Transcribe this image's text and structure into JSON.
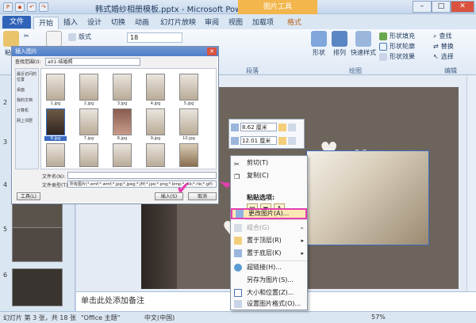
{
  "titlebar": {
    "title": "韩式婚纱相册模板.pptx - Microsoft PowerPoint",
    "context_tab": "图片工具"
  },
  "tabs": [
    "文件",
    "开始",
    "插入",
    "设计",
    "切换",
    "动画",
    "幻灯片放映",
    "审阅",
    "视图",
    "加载项",
    "格式"
  ],
  "ribbon": {
    "paste": "粘贴",
    "cut": "剪切",
    "new_slide": "新建幻灯片",
    "layout": "版式",
    "font_size": "18",
    "section_clipboard": "剪贴板",
    "section_paragraph": "段落",
    "section_drawing": "绘图",
    "section_editing": "编辑",
    "shape": "形状",
    "arrange": "排列",
    "quick_styles": "快速样式",
    "shape_fill": "形状填充",
    "shape_outline": "形状轮廓",
    "shape_effects": "形状效果",
    "find": "查找",
    "replace": "替换",
    "select": "选择"
  },
  "thumbnails": [
    "1",
    "2",
    "3",
    "4",
    "5",
    "6"
  ],
  "dialog": {
    "title": "插入图片",
    "look_in_label": "查找范围(I):",
    "location": "a01-结婚照",
    "places": [
      "最近访问的位置",
      "桌面",
      "我的文档",
      "计算机",
      "网上邻居"
    ],
    "files": [
      "1.jpg",
      "2.jpg",
      "3.jpg",
      "4.jpg",
      "5.jpg",
      "6.jpg",
      "7.jpg",
      "8.jpg",
      "9.jpg",
      "10.jpg",
      "11.jpg",
      "12.jpg",
      "13.jpg",
      "14.jpg",
      "15.jpg"
    ],
    "selected_file": "6.jpg",
    "filename_label": "文件名(N):",
    "filetype_label": "文件类型(T):",
    "filetype_value": "所有图片(*.emf;*.wmf;*.jpg;*.jpeg;*.jfif;*.jpe;*.png;*.bmp;*.dib;*.rle;*.gif)",
    "tools": "工具(L)",
    "insert": "插入(S)",
    "cancel": "取消"
  },
  "minibar": {
    "height": "8.62 厘米",
    "width": "12.01 厘米"
  },
  "context_menu": {
    "cut": "剪切(T)",
    "copy": "复制(C)",
    "paste_options": "粘贴选项:",
    "change_picture": "更改图片(A)...",
    "group": "组合(G)",
    "bring_front": "置于顶层(R)",
    "send_back": "置于底层(K)",
    "hyperlink": "超链接(H)...",
    "save_as_picture": "另存为图片(S)...",
    "size_position": "大小和位置(Z)...",
    "format_picture": "设置图片格式(O)..."
  },
  "notes_placeholder": "单击此处添加备注",
  "statusbar": {
    "slide_info": "幻灯片 第 3 张，共 18 张",
    "theme": "\"Office 主题\"",
    "language": "中文(中国)",
    "zoom": "57%"
  },
  "colors": {
    "highlight_border": "#e33fb0",
    "file_tab": "#2f63b8",
    "context_tab": "#f2b64c"
  }
}
